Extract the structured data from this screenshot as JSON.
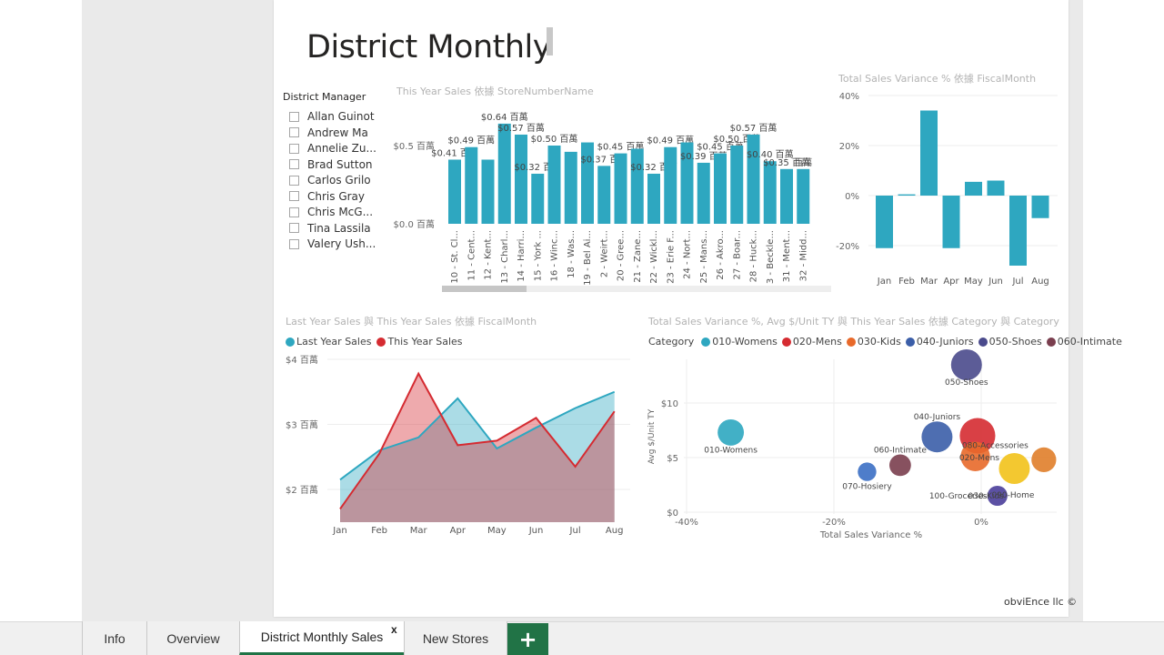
{
  "report": {
    "title": "District Monthly",
    "copyright": "obviEnce llc ©"
  },
  "slicer": {
    "title": "District Manager",
    "items": [
      "Allan Guinot",
      "Andrew Ma",
      "Annelie Zu...",
      "Brad Sutton",
      "Carlos Grilo",
      "Chris Gray",
      "Chris McG...",
      "Tina Lassila",
      "Valery Ush..."
    ]
  },
  "tabs": {
    "items": [
      "Info",
      "Overview",
      "District Monthly Sales",
      "New Stores"
    ],
    "active": "District Monthly Sales",
    "close_label": "x",
    "add_label": "+"
  },
  "colors": {
    "accent": "#217346",
    "bar": "#2ea7c0",
    "last_year": "#2ea7c0",
    "this_year": "#d52b31"
  },
  "chart_data": [
    {
      "id": "store-bar",
      "type": "bar",
      "title": "This Year Sales 依據 StoreNumberName",
      "categories": [
        "10 - St. Cl...",
        "11 - Cent...",
        "12 - Kent...",
        "13 - Charl...",
        "14 - Harri...",
        "15 - York ...",
        "16 - Winc...",
        "18 - Was...",
        "19 - Bel Ai...",
        "2 - Weirt...",
        "20 - Gree...",
        "21 - Zane...",
        "22 - Wickl...",
        "23 - Erie F...",
        "24 - Nort...",
        "25 - Mans...",
        "26 - Akro...",
        "27 - Boar...",
        "28 - Huck...",
        "3 - Beckle...",
        "31 - Ment...",
        "32 - Midd..."
      ],
      "values": [
        0.41,
        0.49,
        0.41,
        0.64,
        0.57,
        0.32,
        0.5,
        0.46,
        0.52,
        0.37,
        0.45,
        0.48,
        0.32,
        0.49,
        0.52,
        0.39,
        0.45,
        0.5,
        0.57,
        0.4,
        0.35,
        0.35
      ],
      "data_labels": [
        "$0.41 百萬",
        "$0.49 百萬",
        "",
        "$0.64 百萬",
        "$0.57 百萬",
        "$0.32 百萬",
        "$0.50 百萬",
        "",
        "",
        "$0.37 百萬",
        "$0.45 百萬",
        "",
        "$0.32 百萬",
        "$0.49 百萬",
        "",
        "$0.39 百萬",
        "$0.45 百萬",
        "$0.50 百萬",
        "$0.57 百萬",
        "$0.40 百萬",
        "$0.35 百萬",
        "百萬"
      ],
      "y_ticks": [
        "$0.0 百萬",
        "$0.5 百萬"
      ],
      "ylim": [
        0,
        0.7
      ]
    },
    {
      "id": "variance-bar",
      "type": "bar",
      "title": "Total Sales Variance % 依據 FiscalMonth",
      "categories": [
        "Jan",
        "Feb",
        "Mar",
        "Apr",
        "May",
        "Jun",
        "Jul",
        "Aug"
      ],
      "values": [
        -21,
        0.5,
        34,
        -21,
        5.5,
        6,
        -28,
        -9
      ],
      "y_ticks": [
        "40%",
        "20%",
        "0%",
        "-20%"
      ],
      "ylim": [
        -28,
        40
      ]
    },
    {
      "id": "sales-area",
      "type": "area",
      "title": "Last Year Sales 與 This Year Sales 依據 FiscalMonth",
      "categories": [
        "Jan",
        "Feb",
        "Mar",
        "Apr",
        "May",
        "Jun",
        "Jul",
        "Aug"
      ],
      "series": [
        {
          "name": "Last Year Sales",
          "values": [
            2.15,
            2.6,
            2.8,
            3.4,
            2.63,
            2.95,
            3.25,
            3.5
          ]
        },
        {
          "name": "This Year Sales",
          "values": [
            1.7,
            2.55,
            3.78,
            2.68,
            2.75,
            3.1,
            2.35,
            3.2
          ]
        }
      ],
      "y_ticks": [
        "$2 百萬",
        "$3 百萬",
        "$4 百萬"
      ],
      "ylim": [
        1.5,
        4
      ]
    },
    {
      "id": "category-scatter",
      "type": "scatter",
      "title": "Total Sales Variance %, Avg $/Unit TY 與 This Year Sales 依據 Category 與 Category",
      "legend_title": "Category",
      "legend": [
        "010-Womens",
        "020-Mens",
        "030-Kids",
        "040-Juniors",
        "050-Shoes",
        "060-Intimate"
      ],
      "xlabel": "Total Sales Variance %",
      "ylabel": "Avg $/Unit TY",
      "x_ticks": [
        "-40%",
        "-20%",
        "0%"
      ],
      "y_ticks": [
        "$0",
        "$5",
        "$10"
      ],
      "xlim": [
        -40,
        10
      ],
      "ylim": [
        0,
        14
      ],
      "points": [
        {
          "label": "010-Womens",
          "x": -34,
          "y": 7.3,
          "size": 1.0,
          "color": "#2ea7c0"
        },
        {
          "label": "020-Mens",
          "x": -0.5,
          "y": 7.0,
          "size": 1.6,
          "color": "#d52b31"
        },
        {
          "label": "030-Kids",
          "x": -0.8,
          "y": 5.1,
          "size": 1.2,
          "color": "#e8692a"
        },
        {
          "label": "040-Juniors",
          "x": -6,
          "y": 6.9,
          "size": 1.3,
          "color": "#3b5ea8"
        },
        {
          "label": "050-Shoes",
          "x": -2,
          "y": 13.5,
          "size": 1.3,
          "color": "#4a4a8c"
        },
        {
          "label": "060-Intimate",
          "x": -11,
          "y": 4.3,
          "size": 0.7,
          "color": "#7a3e4e"
        },
        {
          "label": "070-Hosiery",
          "x": -15.5,
          "y": 3.7,
          "size": 0.5,
          "color": "#3b6fc4"
        },
        {
          "label": "080-Accessories",
          "x": 8.5,
          "y": 4.8,
          "size": 0.9,
          "color": "#e07e2a"
        },
        {
          "label": "090-Home",
          "x": 4.5,
          "y": 4.0,
          "size": 1.3,
          "color": "#f2c21a"
        },
        {
          "label": "100-Groceries",
          "x": 2.2,
          "y": 1.5,
          "size": 0.6,
          "color": "#4a3e9a"
        }
      ]
    }
  ]
}
